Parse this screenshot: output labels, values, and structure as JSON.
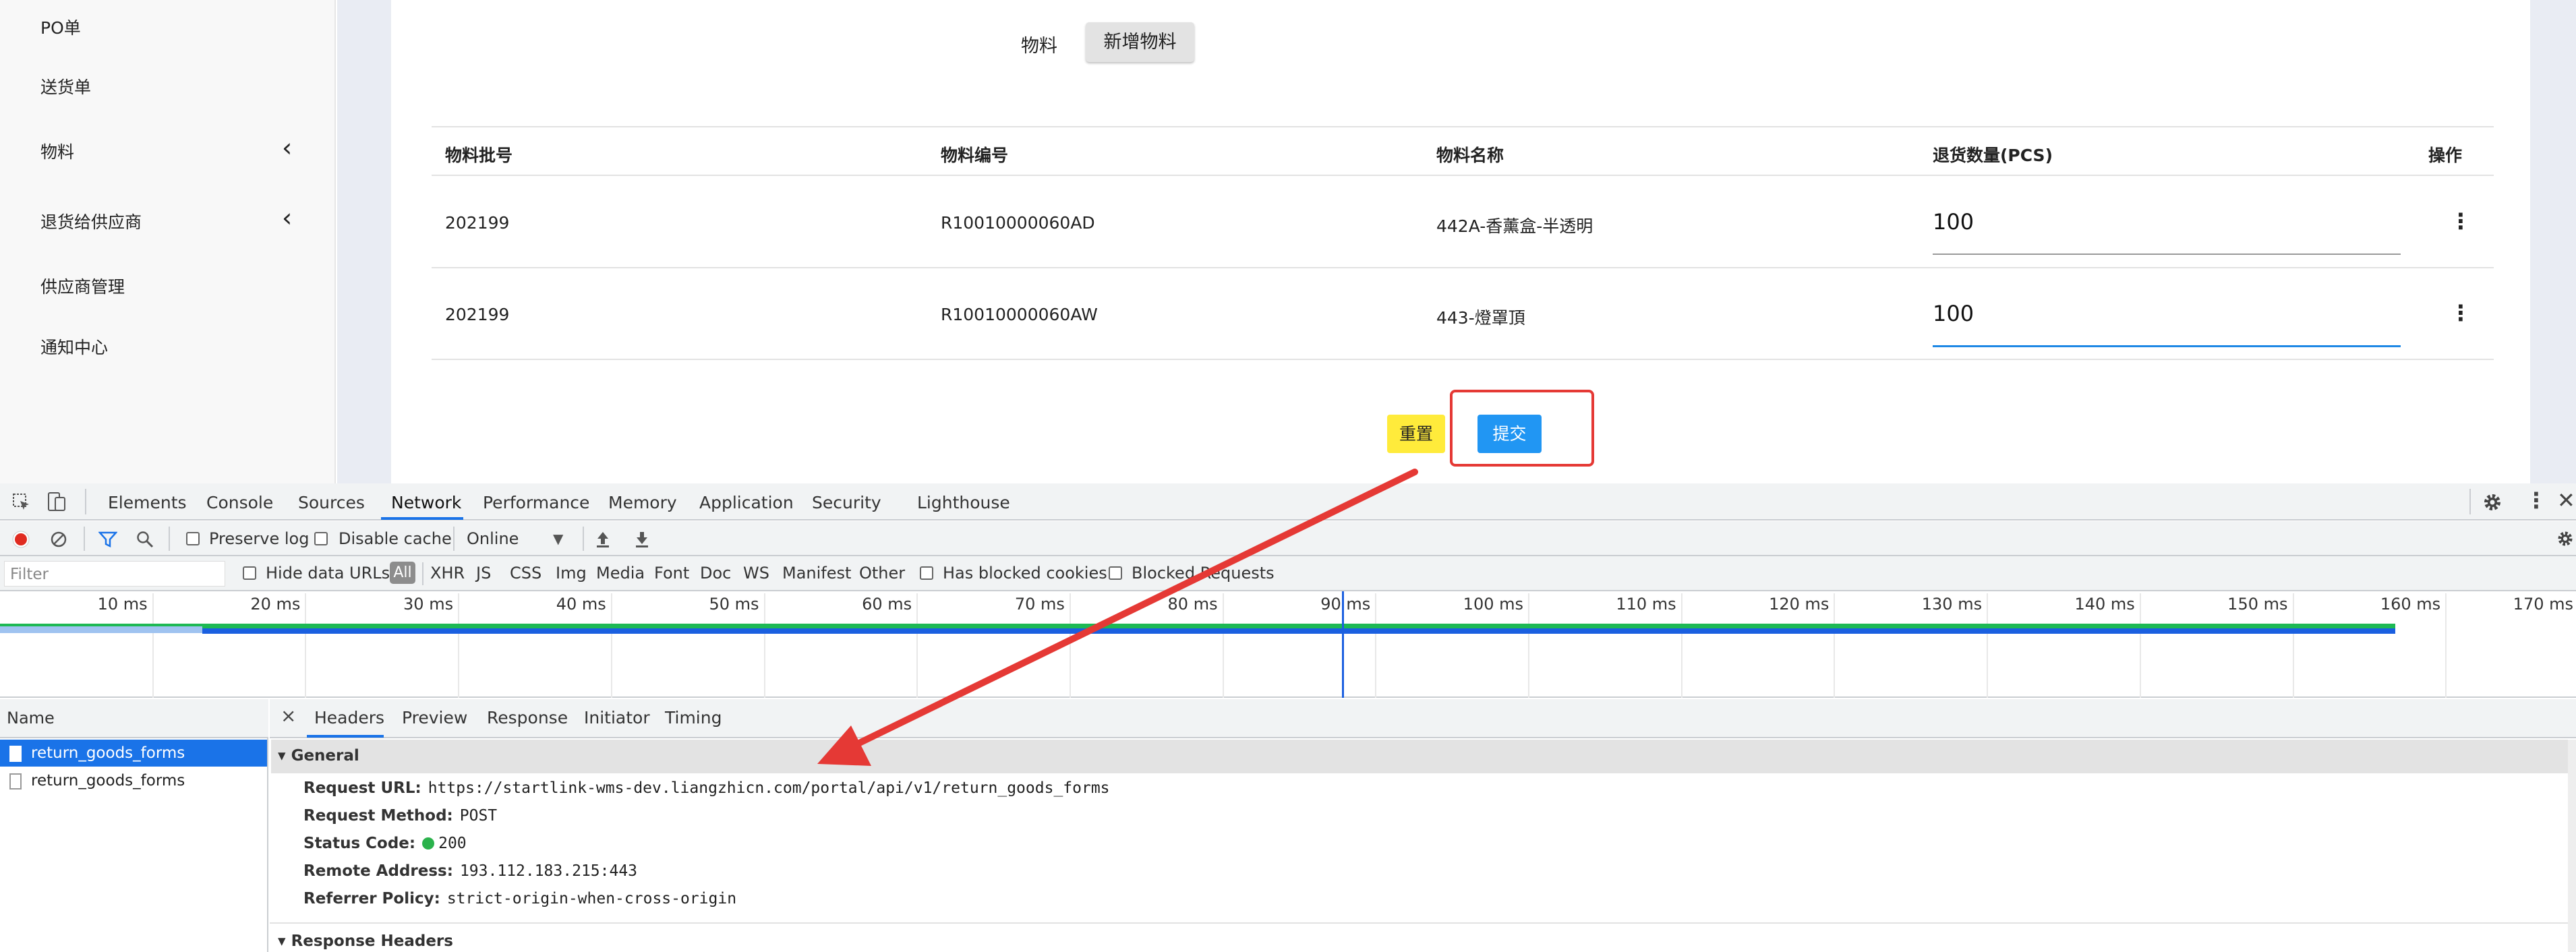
{
  "sidebar": {
    "items": [
      {
        "label": "PO单"
      },
      {
        "label": "送货单"
      },
      {
        "label": "物料",
        "expandable": true,
        "icon": "chevron-left-icon"
      },
      {
        "label": "退货给供应商",
        "expandable": true,
        "icon": "chevron-left-icon"
      },
      {
        "label": "供应商管理"
      },
      {
        "label": "通知中心"
      }
    ]
  },
  "form": {
    "material_label": "物料",
    "add_material_button": "新增物料",
    "table": {
      "headers": [
        "物料批号",
        "物料编号",
        "物料名称",
        "退货数量(PCS)",
        "操作"
      ],
      "rows": [
        {
          "batch": "202199",
          "code": "R10010000060AD",
          "name": "442A-香薰盒-半透明",
          "qty": "100"
        },
        {
          "batch": "202199",
          "code": "R10010000060AW",
          "name": "443-燈罩頂",
          "qty": "100"
        }
      ]
    },
    "reset_button": "重置",
    "submit_button": "提交"
  },
  "devtools": {
    "tabs": [
      "Elements",
      "Console",
      "Sources",
      "Network",
      "Performance",
      "Memory",
      "Application",
      "Security",
      "Lighthouse"
    ],
    "active_tab": "Network",
    "toolbar": {
      "preserve_log": "Preserve log",
      "disable_cache": "Disable cache",
      "throttling": "Online"
    },
    "filter": {
      "placeholder": "Filter",
      "hide_data_urls": "Hide data URLs",
      "types": [
        "All",
        "XHR",
        "JS",
        "CSS",
        "Img",
        "Media",
        "Font",
        "Doc",
        "WS",
        "Manifest",
        "Other"
      ],
      "has_blocked_cookies": "Has blocked cookies",
      "blocked_requests": "Blocked Requests"
    },
    "timeline_ticks": [
      "10 ms",
      "20 ms",
      "30 ms",
      "40 ms",
      "50 ms",
      "60 ms",
      "70 ms",
      "80 ms",
      "90 ms",
      "100 ms",
      "110 ms",
      "120 ms",
      "130 ms",
      "140 ms",
      "150 ms",
      "160 ms",
      "170 ms"
    ],
    "name_header": "Name",
    "requests": [
      {
        "name": "return_goods_forms",
        "selected": true
      },
      {
        "name": "return_goods_forms",
        "selected": false
      }
    ],
    "detail_tabs": [
      "Headers",
      "Preview",
      "Response",
      "Initiator",
      "Timing"
    ],
    "active_detail_tab": "Headers",
    "general": {
      "title": "General",
      "request_url_key": "Request URL:",
      "request_url": "https://startlink-wms-dev.liangzhicn.com/portal/api/v1/return_goods_forms",
      "request_method_key": "Request Method:",
      "request_method": "POST",
      "status_code_key": "Status Code:",
      "status_code": "200",
      "remote_address_key": "Remote Address:",
      "remote_address": "193.112.183.215:443",
      "referrer_policy_key": "Referrer Policy:",
      "referrer_policy": "strict-origin-when-cross-origin"
    },
    "response_headers_title": "Response Headers"
  },
  "colors": {
    "accent": "#1a73e8",
    "submit": "#2196f3",
    "reset": "#ffeb3b",
    "highlight": "#e53935",
    "status_ok": "#2bb24c"
  }
}
